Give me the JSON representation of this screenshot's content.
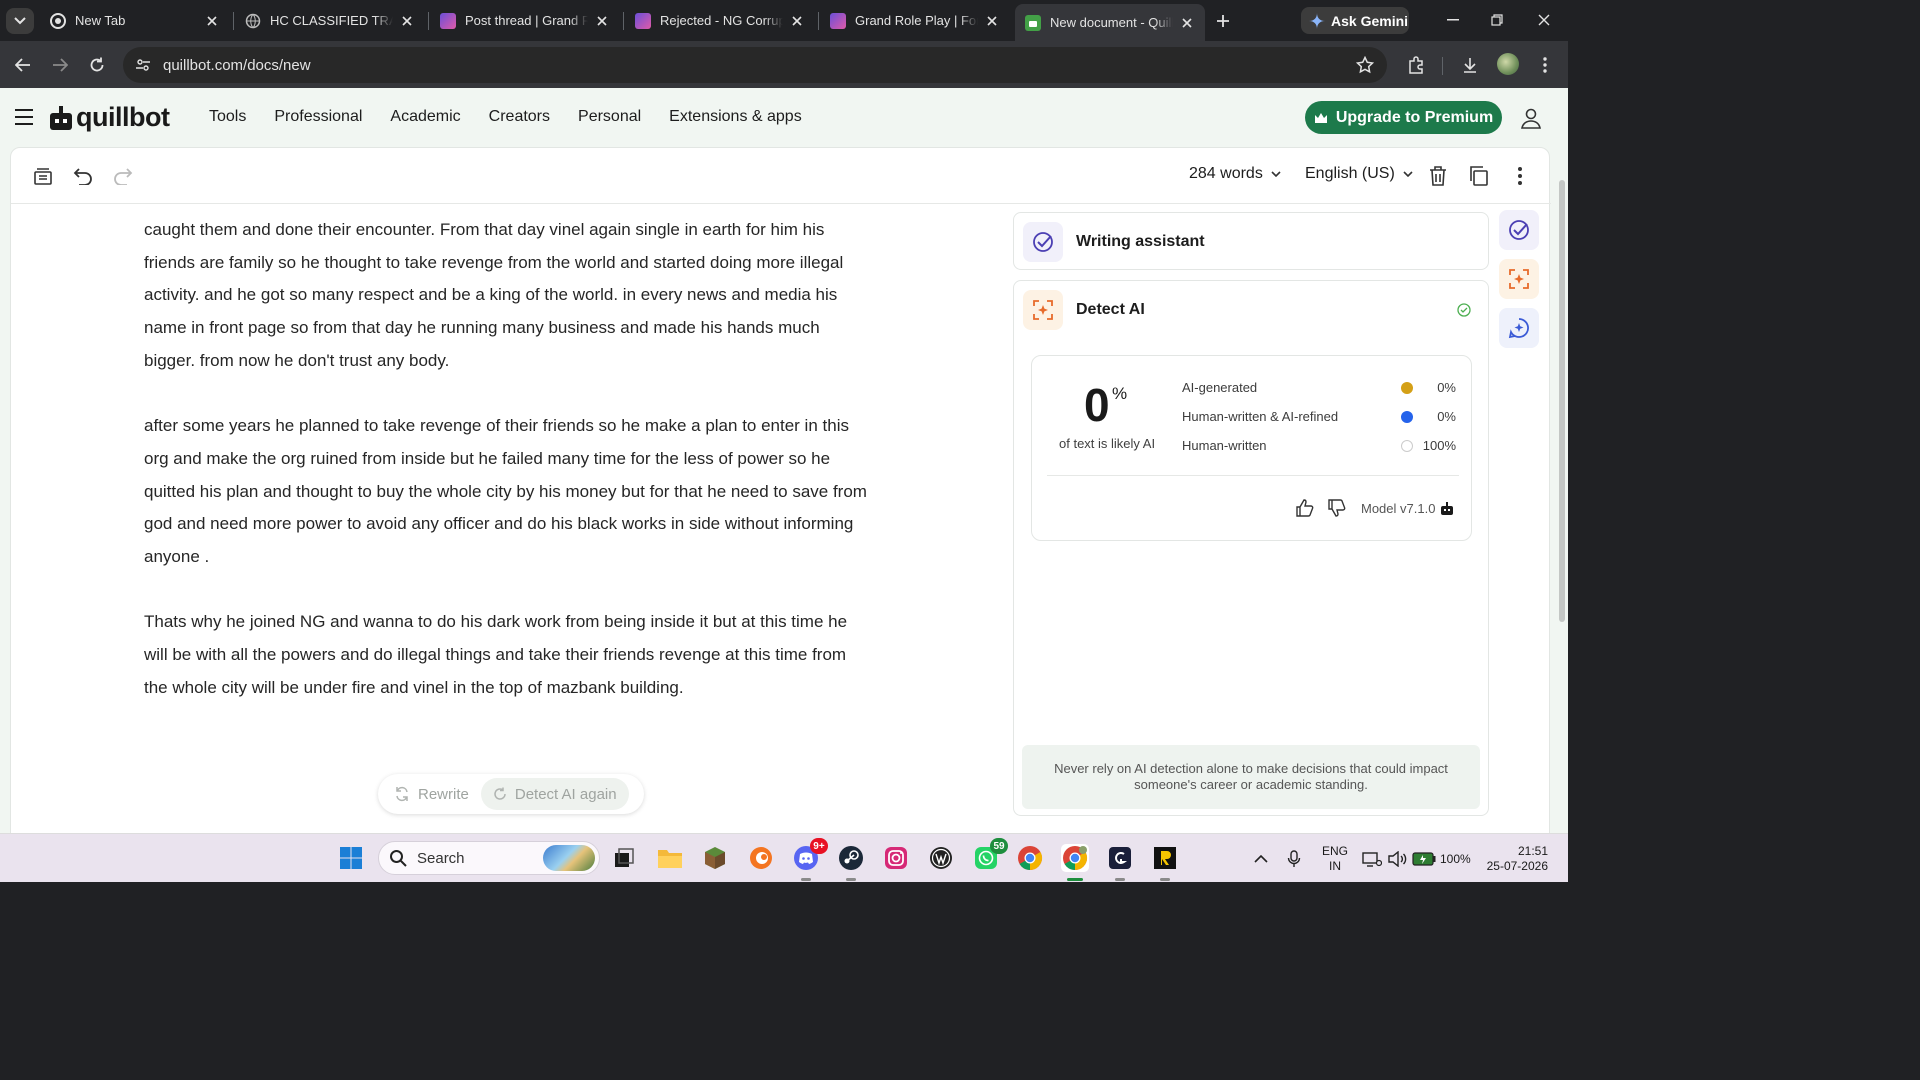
{
  "browser": {
    "tabs": [
      {
        "title": "New Tab",
        "icon": "chrome-icon"
      },
      {
        "title": "HC CLASSIFIED TRAINING",
        "icon": "globe-icon"
      },
      {
        "title": "Post thread | Grand Role Play",
        "icon": "grp-forum-icon"
      },
      {
        "title": "Rejected - NG Corruption",
        "icon": "grp-forum-icon"
      },
      {
        "title": "Grand Role Play | Forum",
        "icon": "grp-forum-icon"
      },
      {
        "title": "New document - QuillBot",
        "icon": "quillbot-icon",
        "active": true
      }
    ],
    "gemini_label": "Ask Gemini",
    "url": "quillbot.com/docs/new"
  },
  "quillbot": {
    "logo_text": "quillbot",
    "nav": [
      "Tools",
      "Professional",
      "Academic",
      "Creators",
      "Personal",
      "Extensions & apps"
    ],
    "premium_label": "Upgrade to Premium",
    "brand_color": "#1d7a4b"
  },
  "editor": {
    "word_count": "284 words",
    "language": "English (US)",
    "paragraphs": [
      "caught them and done their encounter. From that day vinel again single in earth for him his friends are family so he thought to take revenge from the world and started doing more illegal activity. and he got so many respect and be a king of the world. in every news and media his name in front page so from that day he running many business and made his hands much bigger. from now he don't trust any body.",
      "after some years he planned to take revenge of their friends so he make a plan to enter in this org and make the org ruined from inside but he failed many time for the less of power so he quitted his plan and thought to buy the whole city by his money but for that he need to save from god and need more power to avoid any officer and do his black works in side without informing anyone .",
      "Thats why he joined NG and wanna to do his dark work from being inside it but at this time he will be with all the powers and do illegal things and take their friends revenge at this time from the whole city will be under fire and vinel in the top of mazbank building."
    ],
    "rewrite_label": "Rewrite",
    "detect_again_label": "Detect AI again"
  },
  "sidebar": {
    "writing_assistant_title": "Writing assistant",
    "detect_ai_title": "Detect AI",
    "result": {
      "percent": "0",
      "percent_sign": "%",
      "caption": "of text is likely AI",
      "rows": [
        {
          "label": "AI-generated",
          "value": "0%",
          "color": "#d4a017"
        },
        {
          "label": "Human-written & AI-refined",
          "value": "0%",
          "color": "#2563eb"
        },
        {
          "label": "Human-written",
          "value": "100%",
          "color": "#ffffff"
        }
      ],
      "model": "Model v7.1.0"
    },
    "disclaimer": "Never rely on AI detection alone to make decisions that could impact someone's career or academic standing."
  },
  "taskbar": {
    "search_placeholder": "Search",
    "discord_badge": "9+",
    "whatsapp_badge": "59",
    "lang_top": "ENG",
    "lang_bottom": "IN",
    "battery": "100%",
    "time": "21:51",
    "date": "25-07-2026"
  }
}
